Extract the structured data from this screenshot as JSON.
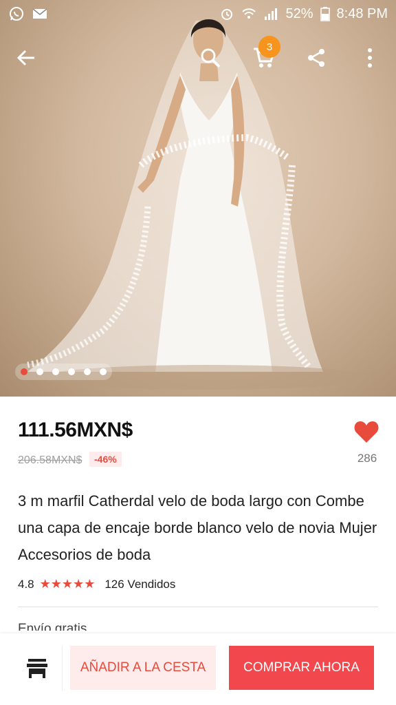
{
  "status_bar": {
    "battery": "52%",
    "time": "8:48 PM"
  },
  "toolbar": {
    "cart_count": "3"
  },
  "carousel": {
    "total_images": 6,
    "active_index": 0
  },
  "product": {
    "price": "111.56MXN$",
    "original_price": "206.58MXN$",
    "discount": "-46%",
    "likes": "286",
    "title": "3 m marfil Catherdal velo de boda largo con Combe una capa de encaje borde blanco velo de novia Mujer Accesorios de boda",
    "rating": "4.8",
    "stars": "★★★★★",
    "sold": "126 Vendidos",
    "shipping": "Envío gratis"
  },
  "actions": {
    "add_to_cart": "AÑADIR A LA CESTA",
    "buy_now": "COMPRAR AHORA"
  },
  "colors": {
    "accent": "#e84a3c",
    "buy_button": "#f2474c",
    "add_button_bg": "#fdeceb",
    "badge": "#f7941d"
  }
}
